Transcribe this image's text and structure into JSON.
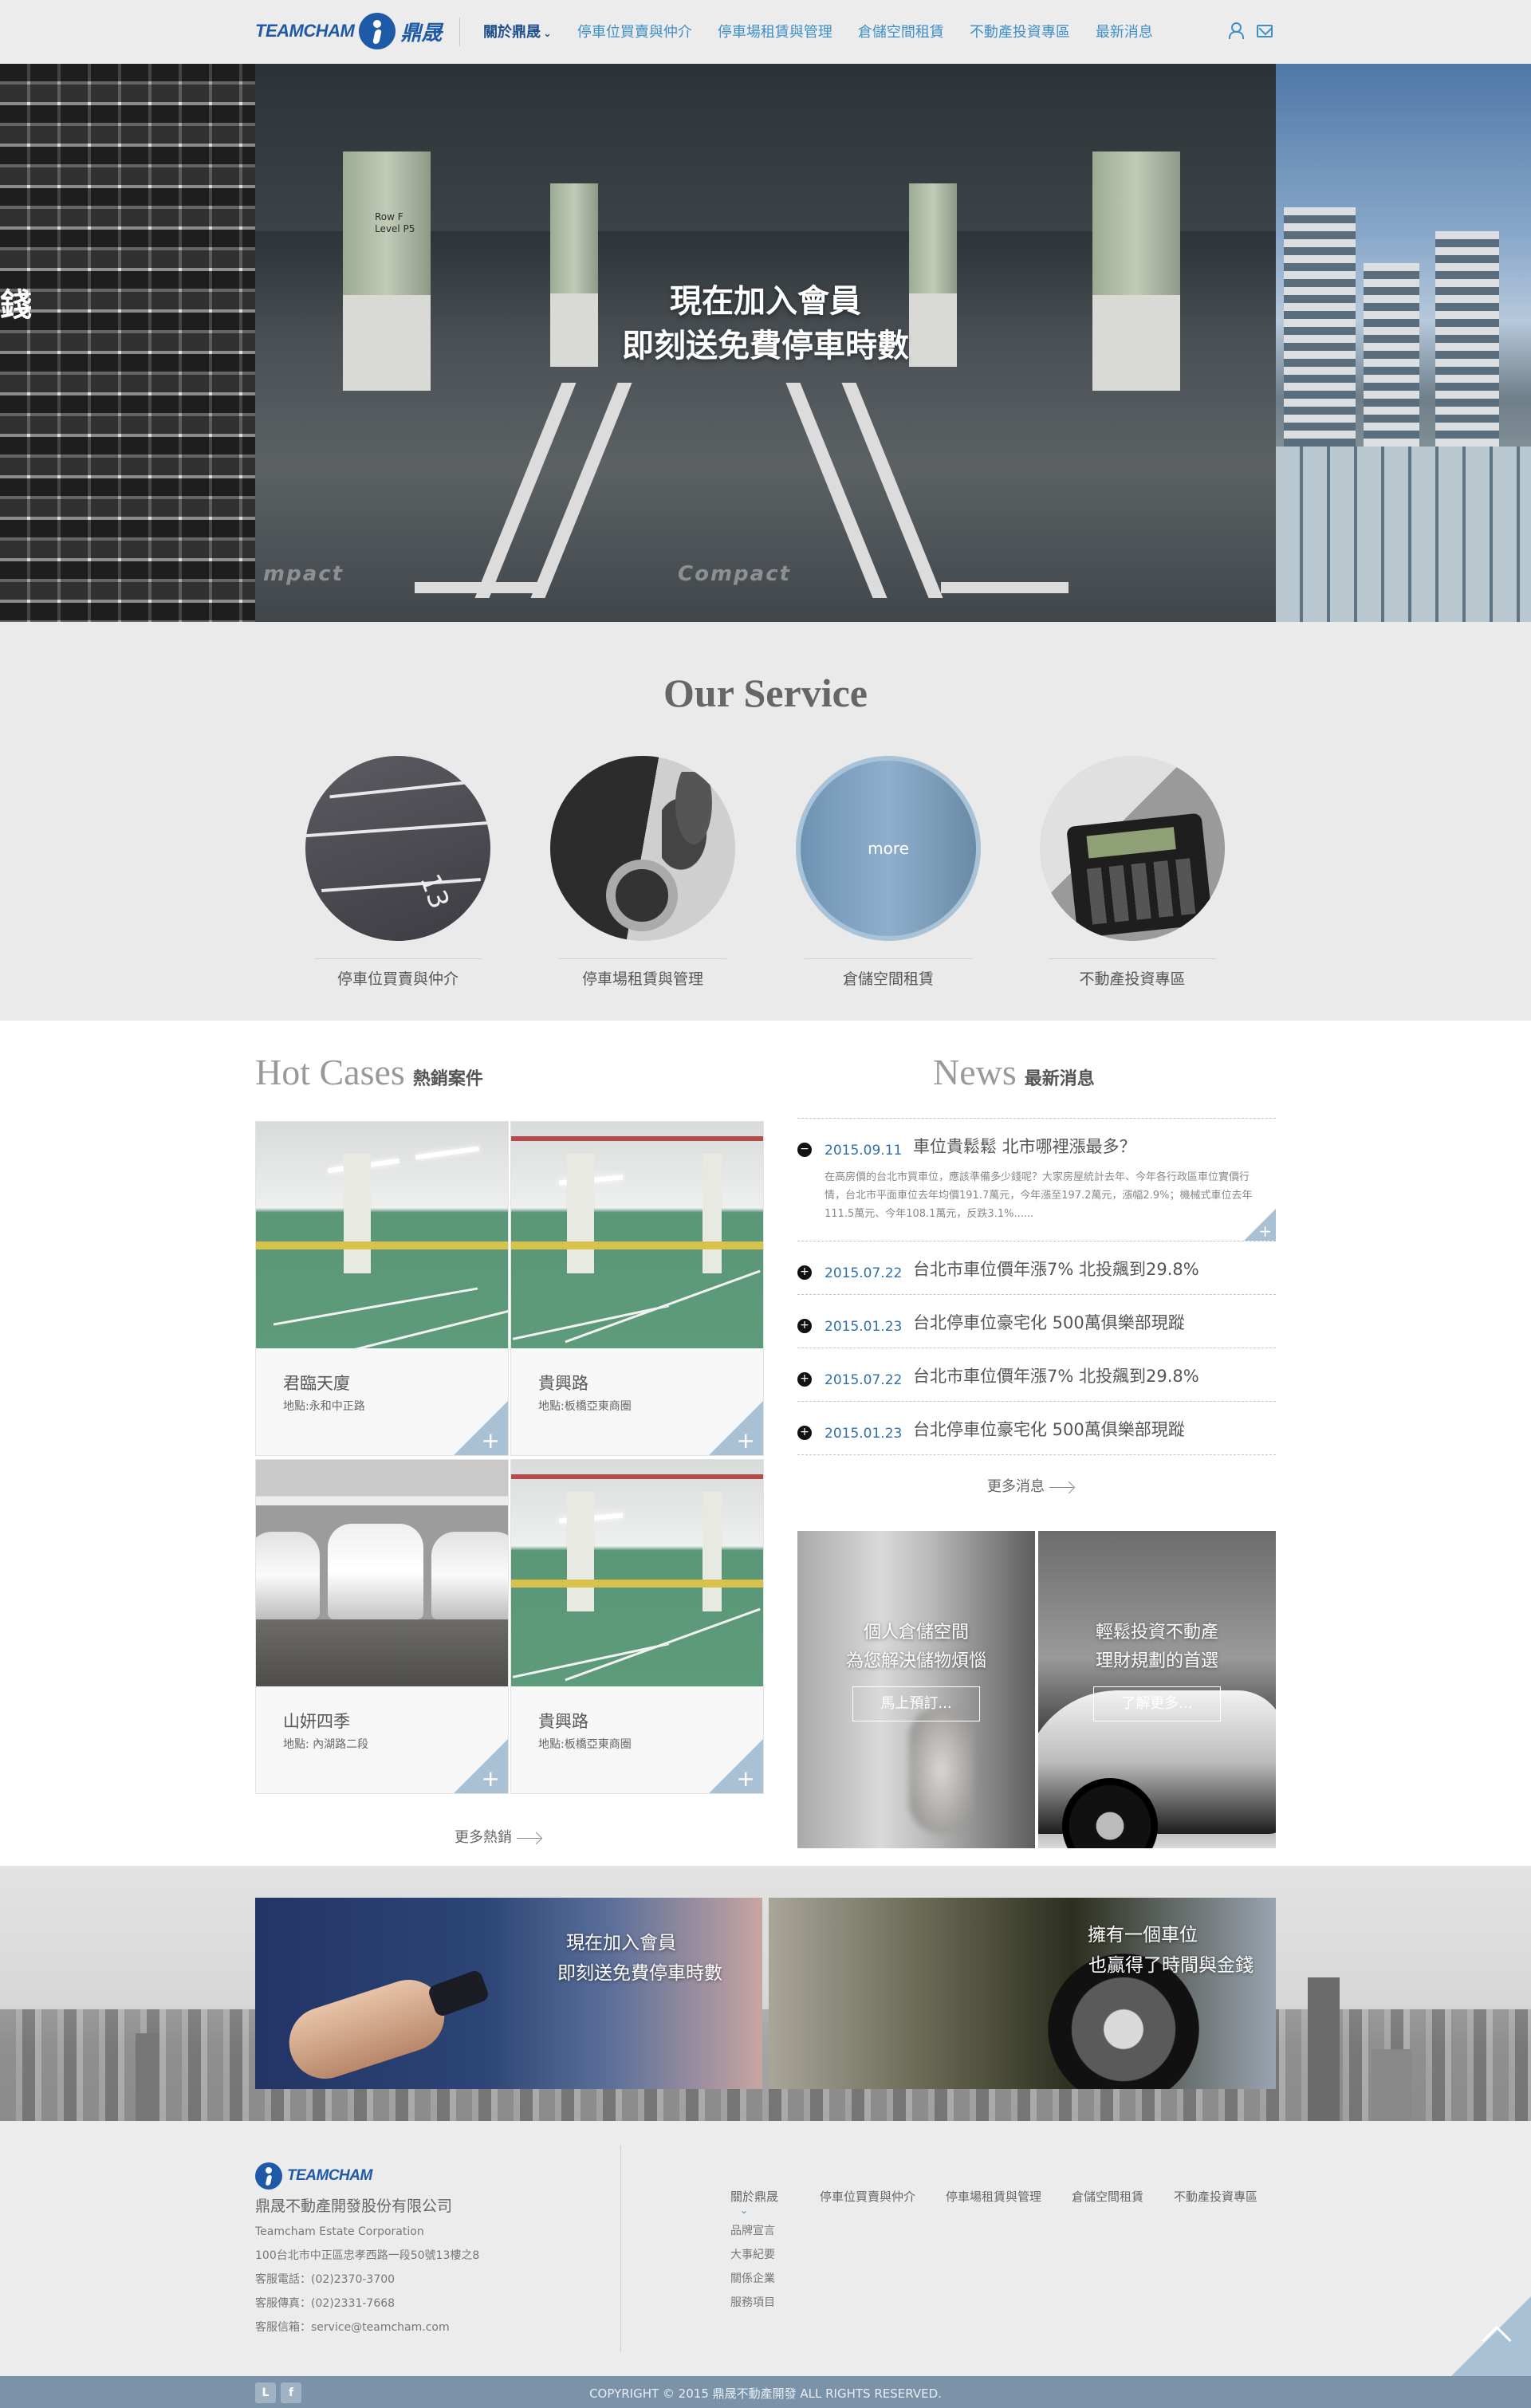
{
  "header": {
    "logo_en": "TEAMCHAM",
    "logo_cn": "鼎晟",
    "nav": [
      {
        "label": "關於鼎晟",
        "active": true
      },
      {
        "label": "停車位買賣與仲介"
      },
      {
        "label": "停車場租賃與管理"
      },
      {
        "label": "倉儲空間租賃"
      },
      {
        "label": "不動產投資專區"
      },
      {
        "label": "最新消息"
      }
    ],
    "icons": [
      "user-icon",
      "mail-icon"
    ]
  },
  "hero": {
    "left_text": "錢",
    "title_line1": "現在加入會員",
    "title_line2": "即刻送免費停車時數",
    "pillar_label_1": "Row F",
    "pillar_label_2": "Level P5",
    "floor_word_1": "mpact",
    "floor_word_2": "Compact",
    "dots": 3,
    "active_dot": 3
  },
  "service": {
    "title": "Our Service",
    "items": [
      {
        "label": "停車位買賣與仲介"
      },
      {
        "label": "停車場租賃與管理"
      },
      {
        "label": "倉儲空間租賃",
        "overlay": "more"
      },
      {
        "label": "不動產投資專區"
      }
    ]
  },
  "hot_cases": {
    "title_en": "Hot Cases",
    "title_cn": "熱銷案件",
    "items": [
      {
        "name": "君臨天廈",
        "address": "地點:永和中正路"
      },
      {
        "name": "貴興路",
        "address": "地點:板橋亞東商圈"
      },
      {
        "name": "山妍四季",
        "address": "地點: 內湖路二段"
      },
      {
        "name": "貴興路",
        "address": "地點:板橋亞東商圈"
      }
    ],
    "more": "更多熱銷"
  },
  "news": {
    "title_en": "News",
    "title_cn": "最新消息",
    "items": [
      {
        "date": "2015.09.11",
        "title": "車位貴鬆鬆 北市哪裡漲最多？",
        "expanded": true,
        "body": "在高房價的台北市買車位，應該準備多少錢呢？大家房屋統計去年、今年各行政區車位實價行情，台北市平面車位去年均價191.7萬元，今年漲至197.2萬元，漲幅2.9%；機械式車位去年111.5萬元、今年108.1萬元，反跌3.1%......"
      },
      {
        "date": "2015.07.22",
        "title": "台北市車位價年漲7% 北投飆到29.8%"
      },
      {
        "date": "2015.01.23",
        "title": "台北停車位豪宅化 500萬俱樂部現蹤"
      },
      {
        "date": "2015.07.22",
        "title": "台北市車位價年漲7% 北投飆到29.8%"
      },
      {
        "date": "2015.01.23",
        "title": "台北停車位豪宅化 500萬俱樂部現蹤"
      }
    ],
    "more": "更多消息",
    "bullet_expanded": "−",
    "bullet_collapsed": "+"
  },
  "promos": [
    {
      "line1": "個人倉儲空間",
      "line2": "為您解決儲物煩惱",
      "button": "馬上預訂..."
    },
    {
      "line1": "輕鬆投資不動產",
      "line2": "理財規劃的首選",
      "button": "了解更多..."
    }
  ],
  "banners": [
    {
      "line1": "現在加入會員",
      "line2": "即刻送免費停車時數"
    },
    {
      "line1": "擁有一個車位",
      "line2": "也贏得了時間與金錢"
    }
  ],
  "footer": {
    "logo_en": "TEAMCHAM",
    "company": "鼎晟不動產開發股份有限公司",
    "company_en": "Teamcham Estate Corporation",
    "address": "100台北市中正區忠孝西路一段50號13樓之8",
    "phone": "客服電話：(02)2370-3700",
    "fax": "客服傳真：(02)2331-7668",
    "email": "客服信箱：service@teamcham.com",
    "nav": [
      "關於鼎晟",
      "停車位買賣與仲介",
      "停車場租賃與管理",
      "倉儲空間租賃",
      "不動產投資專區"
    ],
    "sub_nav": [
      "品牌宣言",
      "大事紀要",
      "關係企業",
      "服務項目"
    ],
    "copyright": "COPYRIGHT © 2015   鼎晟不動產開發 ALL RIGHTS RESERVED.",
    "social": [
      {
        "name": "line-icon",
        "glyph": "L"
      },
      {
        "name": "facebook-icon",
        "glyph": "f"
      }
    ]
  },
  "colors": {
    "brand_blue": "#1f5aa6",
    "nav_blue": "#3f8fc8",
    "accent_light_blue": "#a9c1d5",
    "footer_bar": "#7a93a9"
  }
}
